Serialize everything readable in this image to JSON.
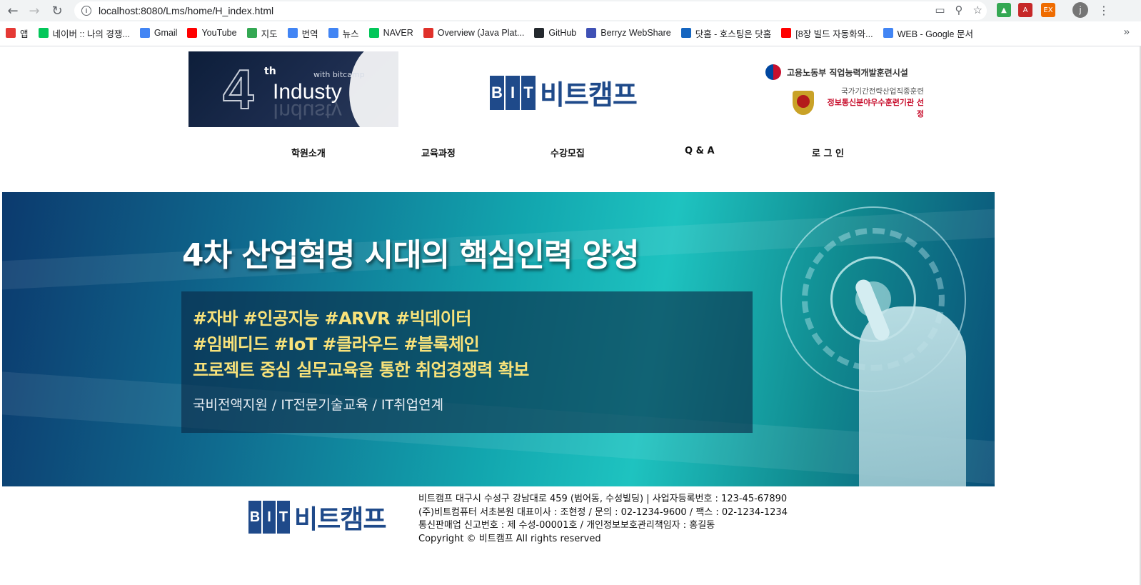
{
  "browser": {
    "url": "localhost:8080/Lms/home/H_index.html",
    "bookmarks": [
      {
        "label": "앱",
        "icon": "apps-grid-icon",
        "color": "#e53935"
      },
      {
        "label": "네이버 :: 나의 경쟁...",
        "icon": "naver-icon",
        "color": "#03c75a"
      },
      {
        "label": "Gmail",
        "icon": "google-icon",
        "color": "#4285f4"
      },
      {
        "label": "YouTube",
        "icon": "youtube-icon",
        "color": "#ff0000"
      },
      {
        "label": "지도",
        "icon": "maps-icon",
        "color": "#34a853"
      },
      {
        "label": "번역",
        "icon": "translate-icon",
        "color": "#4285f4"
      },
      {
        "label": "뉴스",
        "icon": "news-icon",
        "color": "#4285f4"
      },
      {
        "label": "NAVER",
        "icon": "naver-icon",
        "color": "#03c75a"
      },
      {
        "label": "Overview (Java Plat...",
        "icon": "oracle-icon",
        "color": "#e0312b"
      },
      {
        "label": "GitHub",
        "icon": "github-icon",
        "color": "#24292e"
      },
      {
        "label": "Berryz WebShare",
        "icon": "webshare-icon",
        "color": "#3f51b5"
      },
      {
        "label": "닷홈 - 호스팅은 닷홈",
        "icon": "dothome-icon",
        "color": "#1565c0"
      },
      {
        "label": "[8장 빌드 자동화와...",
        "icon": "youtube-icon",
        "color": "#ff0000"
      },
      {
        "label": "WEB - Google 문서",
        "icon": "docs-icon",
        "color": "#4285f4"
      }
    ],
    "more": "»",
    "profile": "j"
  },
  "header": {
    "industry_logo": {
      "number": "4",
      "superscript": "th",
      "with": "with bitcamp",
      "word": "Industy"
    },
    "brand": {
      "letters": [
        "B",
        "I",
        "T"
      ],
      "name": "비트캠프"
    },
    "gov": {
      "ministry": "고용노동부  직업능력개발훈련시설",
      "line_a": "국가기간전략산업직종훈련",
      "line_b": "정보통신분야우수훈련기관 선정"
    }
  },
  "nav": [
    {
      "label": "학원소개"
    },
    {
      "label": "교육과정"
    },
    {
      "label": "수강모집"
    },
    {
      "label": "Q & A"
    },
    {
      "label": "로 그 인"
    }
  ],
  "banner": {
    "headline": "4차 산업혁명 시대의 핵심인력 양성",
    "tags": [
      "#자바 #인공지능 #ARVR #빅데이터",
      "#임베디드 #IoT #클라우드 #블록체인",
      "프로젝트 중심 실무교육을 통한 취업경쟁력 확보"
    ],
    "support": "국비전액지원 / IT전문기술교육 / IT취업연계"
  },
  "footer": {
    "lines": [
      "비트캠프 대구시 수성구 강남대로 459 (범어동, 수성빌딩) | 사업자등록번호 : 123-45-67890",
      "(주)비트컴퓨터 서초본원 대표이사 : 조현정 / 문의 : 02-1234-9600 / 팩스 : 02-1234-1234",
      "통신판매업 신고번호 : 제 수성-00001호 / 개인정보보호관리책임자 : 홍길동",
      "Copyright © 비트캠프 All rights reserved"
    ]
  },
  "colors": {
    "brand_blue": "#1f4a8a",
    "tag_yellow": "#f8e27a",
    "gov_red": "#c8102e"
  }
}
